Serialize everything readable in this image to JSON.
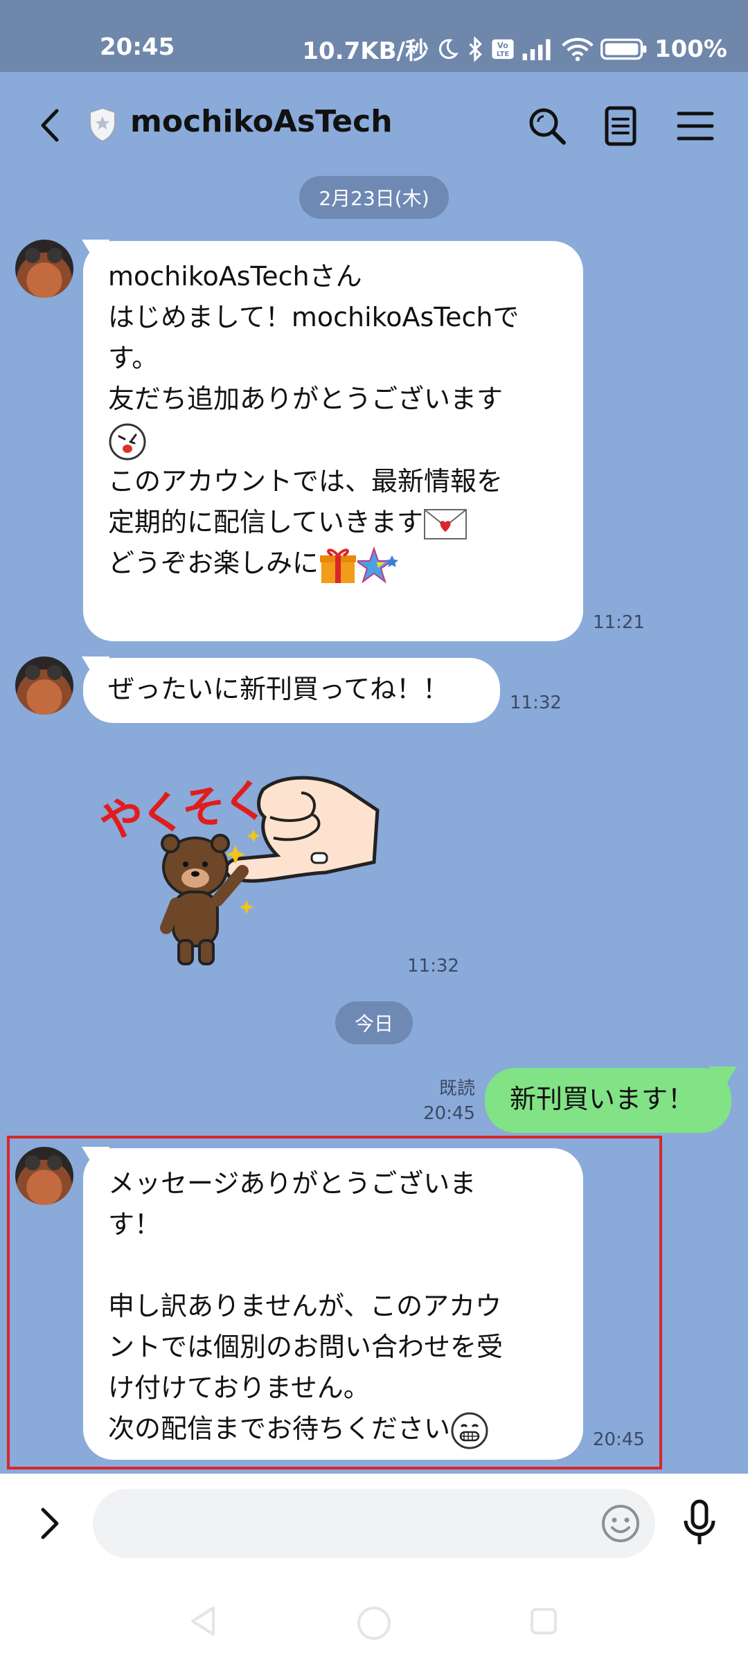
{
  "status_bar": {
    "time": "20:45",
    "network_speed": "10.7KB/秒",
    "volte": "Vo LTE",
    "battery": "100%"
  },
  "header": {
    "title": "mochikoAsTech",
    "icons": [
      "back-arrow",
      "official-shield",
      "search",
      "note",
      "menu"
    ]
  },
  "messages": {
    "date1": "2月23日(木)",
    "msg1": {
      "lines_a": "mochikoAsTechさん\nはじめまして！mochikoAsTechで\nす。\n友だち追加ありがとうございます\n",
      "lines_b": "\nこのアカウントでは、最新情報を\n定期的に配信していきます",
      "lines_c": "\nどうぞお楽しみに",
      "time": "11:21"
    },
    "msg2": {
      "text": "ぜったいに新刊買ってね！！",
      "time": "11:32"
    },
    "sticker": {
      "text": "やくそく",
      "time": "11:32"
    },
    "date2": "今日",
    "msg3": {
      "text": "新刊買います！",
      "read": "既読",
      "time": "20:45"
    },
    "msg4": {
      "text": "メッセージありがとうございま\nす！\n\n申し訳ありませんが、このアカウ\nントでは個別のお問い合わせを受\nけ付けておりません。\n次の配信までお待ちください",
      "time": "20:45"
    }
  },
  "colors": {
    "background": "#8aaad9",
    "status_bar": "#6f87ab",
    "incoming_bubble": "#ffffff",
    "outgoing_bubble": "#82e286",
    "highlight_border": "#d7262b"
  }
}
